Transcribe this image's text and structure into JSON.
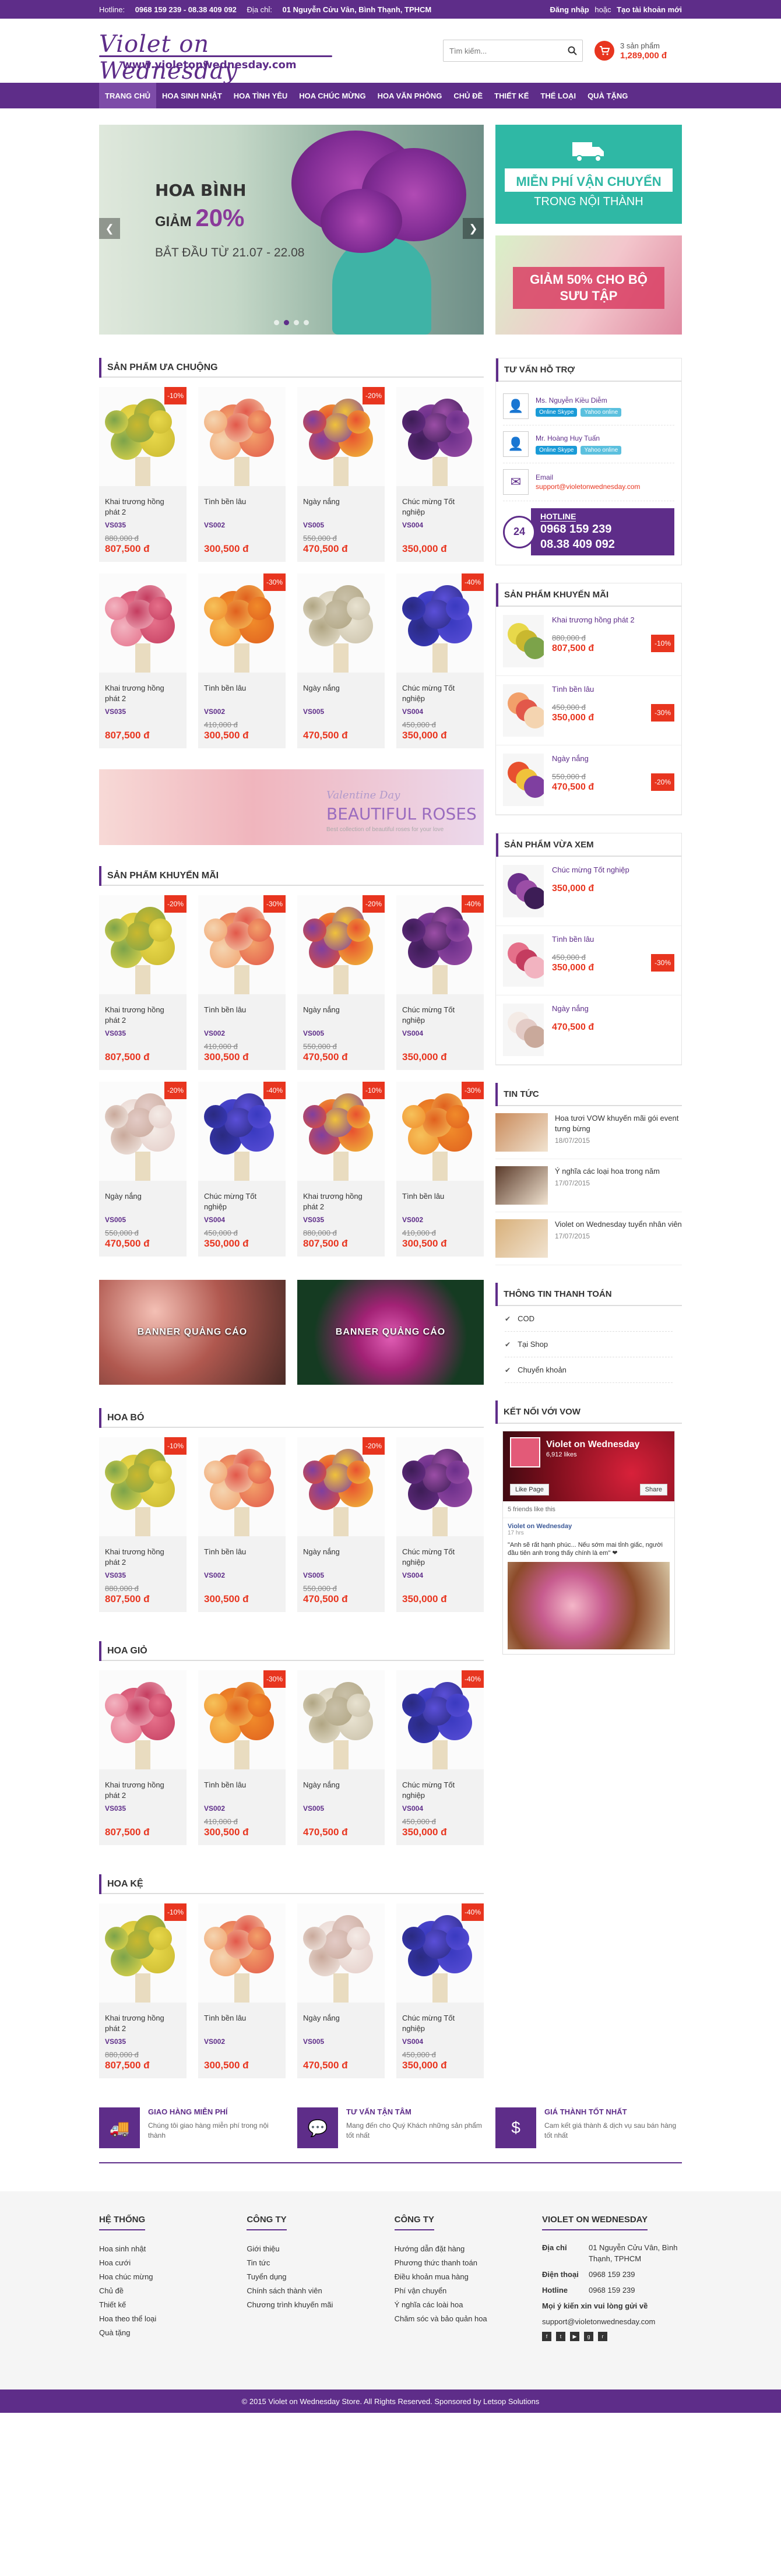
{
  "topbar": {
    "hotline_label": "Hotline:",
    "hotline": "0968 159 239 - 08.38 409 092",
    "address_label": "Địa chỉ:",
    "address": "01 Nguyễn Cửu Vân, Bình Thạnh, TPHCM",
    "login": "Đăng nhập",
    "or": "hoặc",
    "register": "Tạo tài khoản mới"
  },
  "logo": {
    "line1": "Violet on Wednesday",
    "line2": "www.violetonwednesday.com"
  },
  "search": {
    "placeholder": "Tìm kiếm..."
  },
  "cart": {
    "count": "3 sản phẩm",
    "total": "1,289,000 đ"
  },
  "nav": [
    "TRANG CHỦ",
    "HOA SINH NHẬT",
    "HOA TÌNH YÊU",
    "HOA CHÚC MỪNG",
    "HOA VĂN PHÒNG",
    "CHỦ ĐỀ",
    "THIẾT KẾ",
    "THỂ LOẠI",
    "QUÀ TẶNG"
  ],
  "slider": {
    "t1": "HOA BÌNH",
    "t2a": "GIẢM",
    "t2b": "20%",
    "t3": "BẮT ĐẦU TỪ 21.07 - 22.08"
  },
  "side_banner1": {
    "h": "MIỄN PHÍ VẬN CHUYỂN",
    "s": "TRONG NỘI THÀNH"
  },
  "side_banner2": {
    "h": "GIẢM 50% CHO BỘ SƯU TẬP"
  },
  "sections": {
    "popular": "SẢN PHẨM ƯA CHUỘNG",
    "promo": "SẢN PHẨM KHUYẾN MÃI",
    "hoa_bo": "HOA BÓ",
    "hoa_gio": "HOA GIỎ",
    "hoa_ke": "HOA KỆ"
  },
  "popular": [
    {
      "name": "Khai trương hồng phát 2",
      "sku": "VS035",
      "old": "880,000 đ",
      "price": "807,500 đ",
      "sale": "-10%",
      "colors": [
        "#e8d84a",
        "#c9b82f",
        "#7ca34a"
      ]
    },
    {
      "name": "Tình bền lâu",
      "sku": "VS002",
      "old": "",
      "price": "300,500 đ",
      "sale": "",
      "colors": [
        "#f2a06a",
        "#e2584a",
        "#f4d4b0"
      ]
    },
    {
      "name": "Ngày nắng",
      "sku": "VS005",
      "old": "550,000 đ",
      "price": "470,500 đ",
      "sale": "-20%",
      "colors": [
        "#e8512f",
        "#f0c23b",
        "#7f3fa0"
      ]
    },
    {
      "name": "Chúc mừng Tốt nghiệp",
      "sku": "VS004",
      "old": "",
      "price": "350,000 đ",
      "sale": "",
      "colors": [
        "#6b2f8a",
        "#9b4ea6",
        "#3d1d56"
      ]
    },
    {
      "name": "Khai trương hồng phát 2",
      "sku": "VS035",
      "old": "",
      "price": "807,500 đ",
      "sale": "",
      "colors": [
        "#e5708a",
        "#c43c5f",
        "#f2b3c0"
      ]
    },
    {
      "name": "Tình bền lâu",
      "sku": "VS002",
      "old": "410,000 đ",
      "price": "300,500 đ",
      "sale": "-30%",
      "colors": [
        "#f08a2a",
        "#e0601e",
        "#f6c15a"
      ]
    },
    {
      "name": "Ngày nắng",
      "sku": "VS005",
      "old": "",
      "price": "470,500 đ",
      "sale": "",
      "colors": [
        "#e8e2d0",
        "#c9c0a8",
        "#b0a583"
      ]
    },
    {
      "name": "Chúc mừng Tốt nghiệp",
      "sku": "VS004",
      "old": "450,000 đ",
      "price": "350,000 đ",
      "sale": "-40%",
      "colors": [
        "#3a3ac0",
        "#5a4fd8",
        "#2a2a80"
      ]
    }
  ],
  "promo": [
    {
      "name": "Khai trương hồng phát 2",
      "sku": "VS035",
      "old": "",
      "price": "807,500 đ",
      "sale": "-20%",
      "colors": [
        "#e8d84a",
        "#c9b82f",
        "#7ca34a"
      ]
    },
    {
      "name": "Tình bền lâu",
      "sku": "VS002",
      "old": "410,000 đ",
      "price": "300,500 đ",
      "sale": "-30%",
      "colors": [
        "#f2a06a",
        "#e2584a",
        "#f4d4b0"
      ]
    },
    {
      "name": "Ngày nắng",
      "sku": "VS005",
      "old": "550,000 đ",
      "price": "470,500 đ",
      "sale": "-20%",
      "colors": [
        "#e8512f",
        "#f0c23b",
        "#7f3fa0"
      ]
    },
    {
      "name": "Chúc mừng Tốt nghiệp",
      "sku": "VS004",
      "old": "",
      "price": "350,000 đ",
      "sale": "-40%",
      "colors": [
        "#6b2f8a",
        "#9b4ea6",
        "#3d1d56"
      ]
    },
    {
      "name": "Ngày nắng",
      "sku": "VS005",
      "old": "550,000 đ",
      "price": "470,500 đ",
      "sale": "-20%",
      "colors": [
        "#f4ebe6",
        "#e3cbc6",
        "#c9a99b"
      ]
    },
    {
      "name": "Chúc mừng Tốt nghiệp",
      "sku": "VS004",
      "old": "450,000 đ",
      "price": "350,000 đ",
      "sale": "-40%",
      "colors": [
        "#3a3ac0",
        "#5a4fd8",
        "#2a2a80"
      ]
    },
    {
      "name": "Khai trương hồng phát 2",
      "sku": "VS035",
      "old": "880,000 đ",
      "price": "807,500 đ",
      "sale": "-10%",
      "colors": [
        "#e8512f",
        "#f0c23b",
        "#7f3fa0"
      ]
    },
    {
      "name": "Tình bền lâu",
      "sku": "VS002",
      "old": "410,000 đ",
      "price": "300,500 đ",
      "sale": "-30%",
      "colors": [
        "#f08a2a",
        "#e0601e",
        "#f6c15a"
      ]
    }
  ],
  "wide_banner": {
    "t1": "Valentine Day",
    "t2": "BEAUTIFUL ROSES",
    "t3": "Best collection of beautiful roses for your love"
  },
  "two_banners": [
    "BANNER QUẢNG CÁO",
    "BANNER QUẢNG CÁO"
  ],
  "hoa_bo": [
    {
      "name": "Khai trương hồng phát 2",
      "sku": "VS035",
      "old": "880,000 đ",
      "price": "807,500 đ",
      "sale": "-10%",
      "colors": [
        "#e8d84a",
        "#c9b82f",
        "#7ca34a"
      ]
    },
    {
      "name": "Tình bền lâu",
      "sku": "VS002",
      "old": "",
      "price": "300,500 đ",
      "sale": "",
      "colors": [
        "#f2a06a",
        "#e2584a",
        "#f4d4b0"
      ]
    },
    {
      "name": "Ngày nắng",
      "sku": "VS005",
      "old": "550,000 đ",
      "price": "470,500 đ",
      "sale": "-20%",
      "colors": [
        "#e8512f",
        "#f0c23b",
        "#7f3fa0"
      ]
    },
    {
      "name": "Chúc mừng Tốt nghiệp",
      "sku": "VS004",
      "old": "",
      "price": "350,000 đ",
      "sale": "",
      "colors": [
        "#6b2f8a",
        "#9b4ea6",
        "#3d1d56"
      ]
    }
  ],
  "hoa_gio": [
    {
      "name": "Khai trương hồng phát 2",
      "sku": "VS035",
      "old": "",
      "price": "807,500 đ",
      "sale": "",
      "colors": [
        "#e5708a",
        "#c43c5f",
        "#f2b3c0"
      ]
    },
    {
      "name": "Tình bền lâu",
      "sku": "VS002",
      "old": "410,000 đ",
      "price": "300,500 đ",
      "sale": "-30%",
      "colors": [
        "#f08a2a",
        "#e0601e",
        "#f6c15a"
      ]
    },
    {
      "name": "Ngày nắng",
      "sku": "VS005",
      "old": "",
      "price": "470,500 đ",
      "sale": "",
      "colors": [
        "#e8e2d0",
        "#c9c0a8",
        "#b0a583"
      ]
    },
    {
      "name": "Chúc mừng Tốt nghiệp",
      "sku": "VS004",
      "old": "450,000 đ",
      "price": "350,000 đ",
      "sale": "-40%",
      "colors": [
        "#3a3ac0",
        "#5a4fd8",
        "#2a2a80"
      ]
    }
  ],
  "hoa_ke": [
    {
      "name": "Khai trương hồng phát 2",
      "sku": "VS035",
      "old": "880,000 đ",
      "price": "807,500 đ",
      "sale": "-10%",
      "colors": [
        "#e8d84a",
        "#c9b82f",
        "#7ca34a"
      ]
    },
    {
      "name": "Tình bền lâu",
      "sku": "VS002",
      "old": "",
      "price": "300,500 đ",
      "sale": "",
      "colors": [
        "#f2a06a",
        "#e2584a",
        "#f4d4b0"
      ]
    },
    {
      "name": "Ngày nắng",
      "sku": "VS005",
      "old": "",
      "price": "470,500 đ",
      "sale": "",
      "colors": [
        "#f4ebe6",
        "#e3cbc6",
        "#c9a99b"
      ]
    },
    {
      "name": "Chúc mừng Tốt nghiệp",
      "sku": "VS004",
      "old": "450,000 đ",
      "price": "350,000 đ",
      "sale": "-40%",
      "colors": [
        "#3a3ac0",
        "#5a4fd8",
        "#2a2a80"
      ]
    }
  ],
  "support": {
    "title": "TƯ VẤN HỖ TRỢ",
    "p1": "Ms. Nguyễn Kiều Diễm",
    "p2": "Mr. Hoàng Huy Tuấn",
    "chat1": "Online Skype",
    "chat2": "Yahoo online",
    "email_label": "Email",
    "email": "support@violetonwednesday.com",
    "hotline_label": "HOTLINE",
    "hotline1": "0968 159 239",
    "hotline2": "08.38 409 092",
    "badge": "24"
  },
  "side_promo": {
    "title": "SẢN PHẨM KHUYẾN MÃI",
    "items": [
      {
        "name": "Khai trương hồng phát 2",
        "old": "880,000 đ",
        "price": "807,500 đ",
        "sale": "-10%",
        "colors": [
          "#e8d84a",
          "#c9b82f",
          "#7ca34a"
        ]
      },
      {
        "name": "Tình bền lâu",
        "old": "450,000 đ",
        "price": "350,000 đ",
        "sale": "-30%",
        "colors": [
          "#f2a06a",
          "#e2584a",
          "#f4d4b0"
        ]
      },
      {
        "name": "Ngày nắng",
        "old": "550,000 đ",
        "price": "470,500 đ",
        "sale": "-20%",
        "colors": [
          "#e8512f",
          "#f0c23b",
          "#7f3fa0"
        ]
      }
    ]
  },
  "side_viewed": {
    "title": "SẢN PHẨM VỪA XEM",
    "items": [
      {
        "name": "Chúc mừng Tốt nghiệp",
        "old": "",
        "price": "350,000 đ",
        "sale": "",
        "colors": [
          "#6b2f8a",
          "#9b4ea6",
          "#3d1d56"
        ]
      },
      {
        "name": "Tình bền lâu",
        "old": "450,000 đ",
        "price": "350,000 đ",
        "sale": "-30%",
        "colors": [
          "#e5708a",
          "#c43c5f",
          "#f2b3c0"
        ]
      },
      {
        "name": "Ngày nắng",
        "old": "",
        "price": "470,500 đ",
        "sale": "",
        "colors": [
          "#f4ebe6",
          "#e3cbc6",
          "#c9a99b"
        ]
      }
    ]
  },
  "news": {
    "title": "TIN TỨC",
    "items": [
      {
        "title": "Hoa tươi VOW khuyến mãi gói event tưng bừng",
        "date": "18/07/2015",
        "color": "#c98a5a"
      },
      {
        "title": "Ý nghĩa các loại hoa trong năm",
        "date": "17/07/2015",
        "color": "#5a3a2a"
      },
      {
        "title": "Violet on Wednesday tuyển nhân viên",
        "date": "17/07/2015",
        "color": "#d8b07a"
      }
    ]
  },
  "payment": {
    "title": "THÔNG TIN THANH TOÁN",
    "items": [
      "COD",
      "Tại Shop",
      "Chuyển khoản"
    ]
  },
  "facebook": {
    "title": "KẾT NỐI VỚI VOW",
    "page": "Violet on Wednesday",
    "likes": "6,912 likes",
    "like_btn": "Like Page",
    "share_btn": "Share",
    "friends": "5 friends like this",
    "post_author": "Violet on Wednesday",
    "post_time": "17 hrs",
    "post_text": "\"Anh sẽ rất hạnh phúc... Nếu sớm mai tỉnh giấc, người đầu tiên anh trong thấy chính là em\" ❤"
  },
  "features": [
    {
      "h": "GIAO HÀNG MIỄN PHÍ",
      "s": "Chúng tôi giao hàng miễn phí trong nội thành",
      "icon": "🚚"
    },
    {
      "h": "TƯ VẤN TẬN TÂM",
      "s": "Mang đến cho Quý Khách những sản phẩm tốt nhất",
      "icon": "💬"
    },
    {
      "h": "GIÁ THÀNH TỐT NHẤT",
      "s": "Cam kết giá thành & dịch vụ sau bán hàng tốt nhất",
      "icon": "$"
    }
  ],
  "footer": {
    "col1": {
      "h": "HỆ THỐNG",
      "items": [
        "Hoa sinh nhật",
        "Hoa cưới",
        "Hoa chúc mừng",
        "Chủ đề",
        "Thiết kế",
        "Hoa theo thể loại",
        "Quà tặng"
      ]
    },
    "col2": {
      "h": "CÔNG TY",
      "items": [
        "Giới thiệu",
        "Tin tức",
        "Tuyển dụng",
        "Chính sách thành viên",
        "Chương trình khuyến mãi"
      ]
    },
    "col3": {
      "h": "CÔNG TY",
      "items": [
        "Hướng dẫn đặt hàng",
        "Phương thức thanh toán",
        "Điều khoản mua hàng",
        "Phí vận chuyển",
        "Ý nghĩa các loài hoa",
        "Chăm sóc và bảo quản hoa"
      ]
    },
    "col4": {
      "h": "VIOLET ON WEDNESDAY",
      "addr_label": "Địa chỉ",
      "addr": "01 Nguyễn Cửu Vân, Bình Thạnh, TPHCM",
      "phone_label": "Điện thoại",
      "phone": "0968 159 239",
      "hot_label": "Hotline",
      "hot": "0968 159 239",
      "mail_note": "Mọi ý kiến xin vui lòng gửi về",
      "mail": "support@violetonwednesday.com"
    },
    "copyright": "© 2015 Violet on Wednesday Store. All Rights Reserved. Sponsored by Letsop Solutions"
  }
}
